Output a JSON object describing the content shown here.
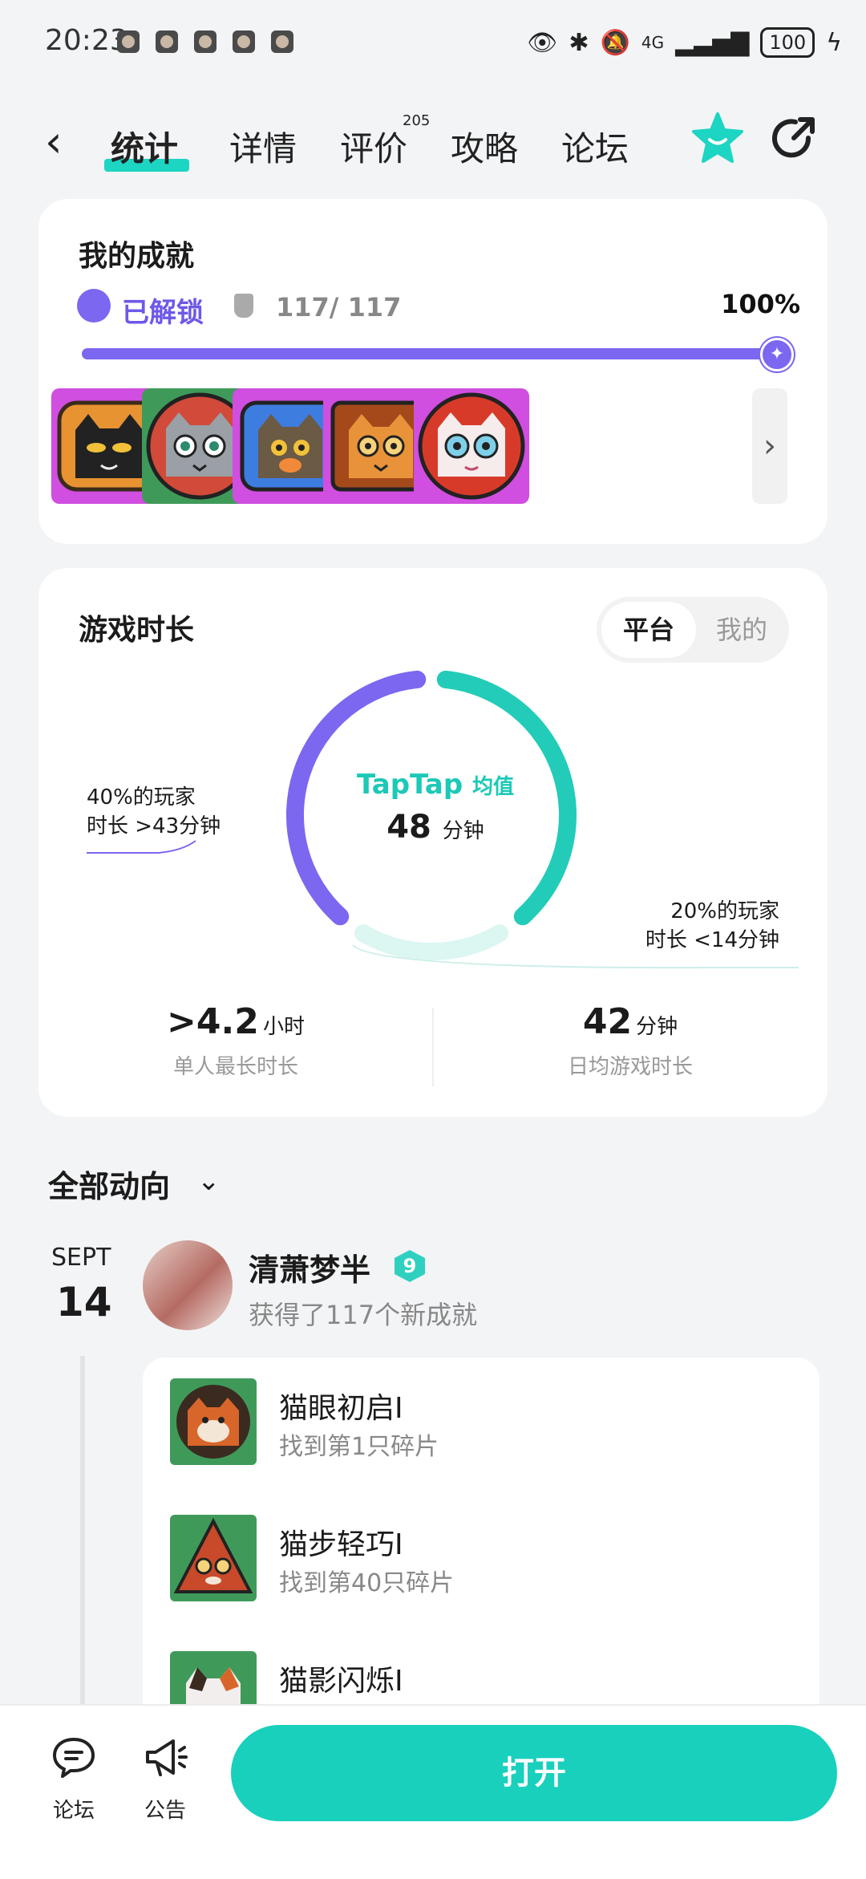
{
  "status_bar": {
    "time": "20:23",
    "network": "4G",
    "battery": "100"
  },
  "nav": {
    "tabs": [
      {
        "label": "统计",
        "active": true
      },
      {
        "label": "详情"
      },
      {
        "label": "评价"
      },
      {
        "label": "攻略"
      },
      {
        "label": "论坛"
      }
    ],
    "review_count": "205",
    "accent": "#1cd5c2"
  },
  "achievements": {
    "title": "我的成就",
    "unlocked_label": "已解锁",
    "count": "117/ 117",
    "percent_label": "100%",
    "progress": 1.0,
    "badges": [
      "black-cat-badge",
      "grey-cat-badge",
      "tabby-cat-badge",
      "orange-cat-badge",
      "white-cat-badge"
    ]
  },
  "playtime": {
    "title": "游戏时长",
    "segment": {
      "platform": "平台",
      "mine": "我的"
    },
    "logo": "TapTap",
    "avg_label": "均值",
    "avg_value": "48",
    "avg_unit": "分钟",
    "left_note_line1": "40%的玩家",
    "left_note_line2": "时长 >43分钟",
    "right_note_line1": "20%的玩家",
    "right_note_line2": "时长 <14分钟",
    "ring_shares": {
      "over_43min": 0.4,
      "middle": 0.4,
      "under_14min": 0.2
    },
    "ring_colors": {
      "purple": "#7b67f0",
      "teal": "#22ccb8",
      "light": "#dcf6f2"
    },
    "stats": [
      {
        "value": ">4.2",
        "unit": "小时",
        "label": "单人最长时长"
      },
      {
        "value": "42",
        "unit": "分钟",
        "label": "日均游戏时长"
      }
    ]
  },
  "feed": {
    "header": "全部动向",
    "date": {
      "month": "SEPT",
      "day": "14"
    },
    "user": {
      "name": "清萧梦半",
      "level": "9"
    },
    "activity": "获得了117个新成就",
    "achievements": [
      {
        "name": "猫眼初启I",
        "desc": "找到第1只碎片"
      },
      {
        "name": "猫步轻巧I",
        "desc": "找到第40只碎片"
      },
      {
        "name": "猫影闪烁I",
        "desc": ""
      }
    ]
  },
  "bottom_bar": {
    "forum_label": "论坛",
    "notice_label": "公告",
    "open_label": "打开"
  }
}
